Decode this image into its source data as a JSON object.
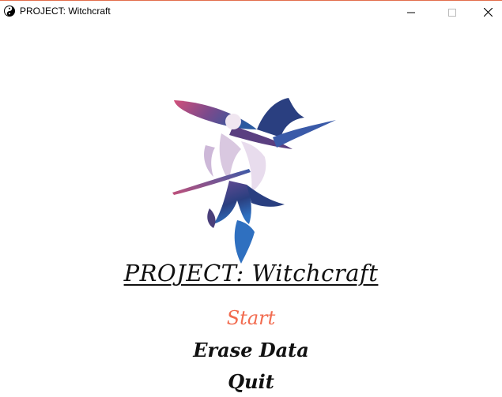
{
  "window": {
    "title": "PROJECT: Witchcraft",
    "icon": "yin-yang-icon",
    "controls": [
      "minimize-icon",
      "maximize-icon",
      "close-icon"
    ]
  },
  "game": {
    "title": "PROJECT: Witchcraft",
    "artwork": "witch-silhouette-illustration"
  },
  "menu": {
    "items": [
      {
        "label": "Start",
        "selected": true
      },
      {
        "label": "Erase Data",
        "selected": false
      },
      {
        "label": "Quit",
        "selected": false
      }
    ],
    "selected_color": "#f26b4f",
    "default_color": "#111111"
  },
  "colors": {
    "window_border": "#e36d4b",
    "art_pink": "#c0507a",
    "art_blue": "#2a5aa0",
    "art_navy": "#2a2f5e"
  }
}
